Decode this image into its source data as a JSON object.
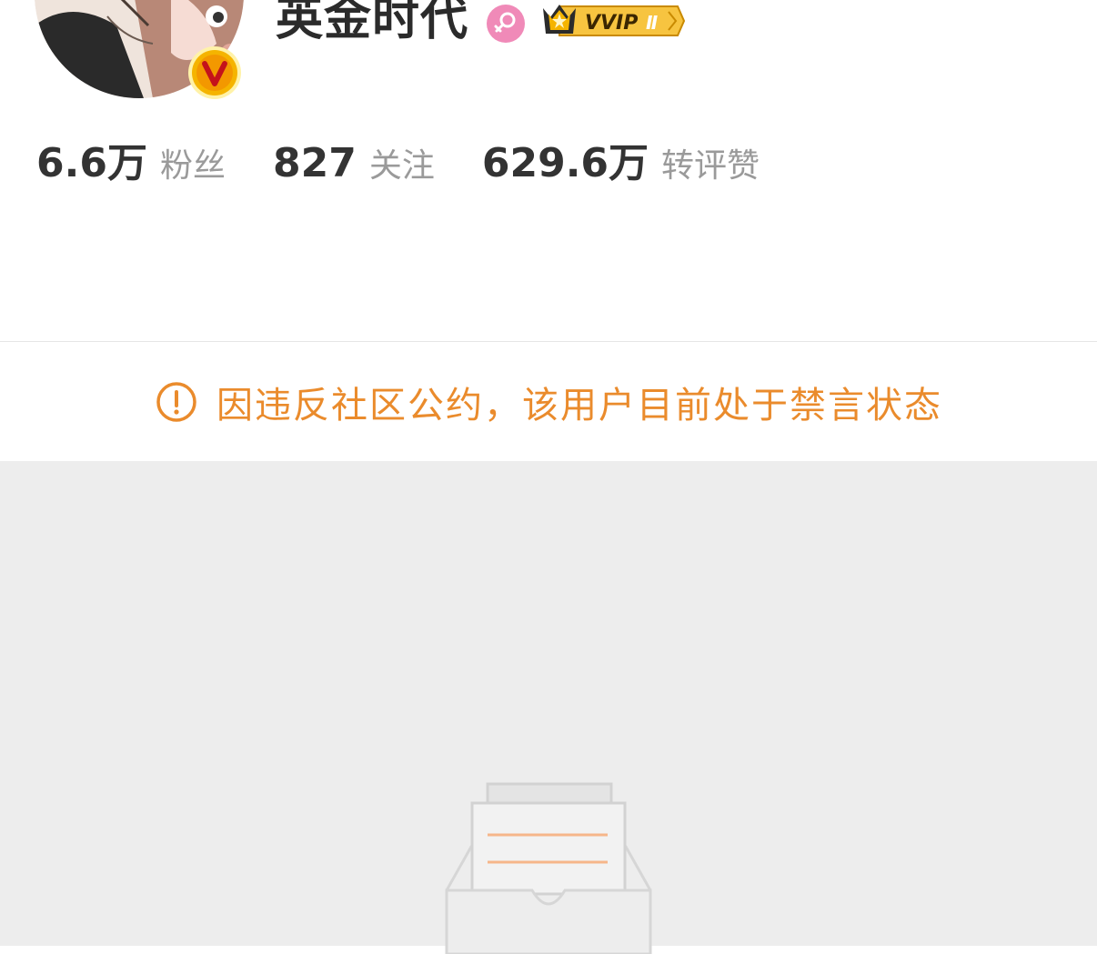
{
  "profile": {
    "username": "英金时代",
    "verified": true,
    "gender": "female",
    "vip_badge": {
      "label": "VVIP",
      "level": "Ⅱ"
    },
    "stats": [
      {
        "value": "6.6万",
        "label": "粉丝"
      },
      {
        "value": "827",
        "label": "关注"
      },
      {
        "value": "629.6万",
        "label": "转评赞"
      }
    ]
  },
  "notice": {
    "icon": "exclamation-circle-icon",
    "text": "因违反社区公约，该用户目前处于禁言状态"
  },
  "empty_state": {
    "icon": "empty-inbox-icon"
  },
  "colors": {
    "notice": "#ea8b2c",
    "verified_badge": "#f5b400",
    "gender_badge": "#f08ab8",
    "vip_gold": "#f7c440",
    "content_bg": "#ededed"
  }
}
